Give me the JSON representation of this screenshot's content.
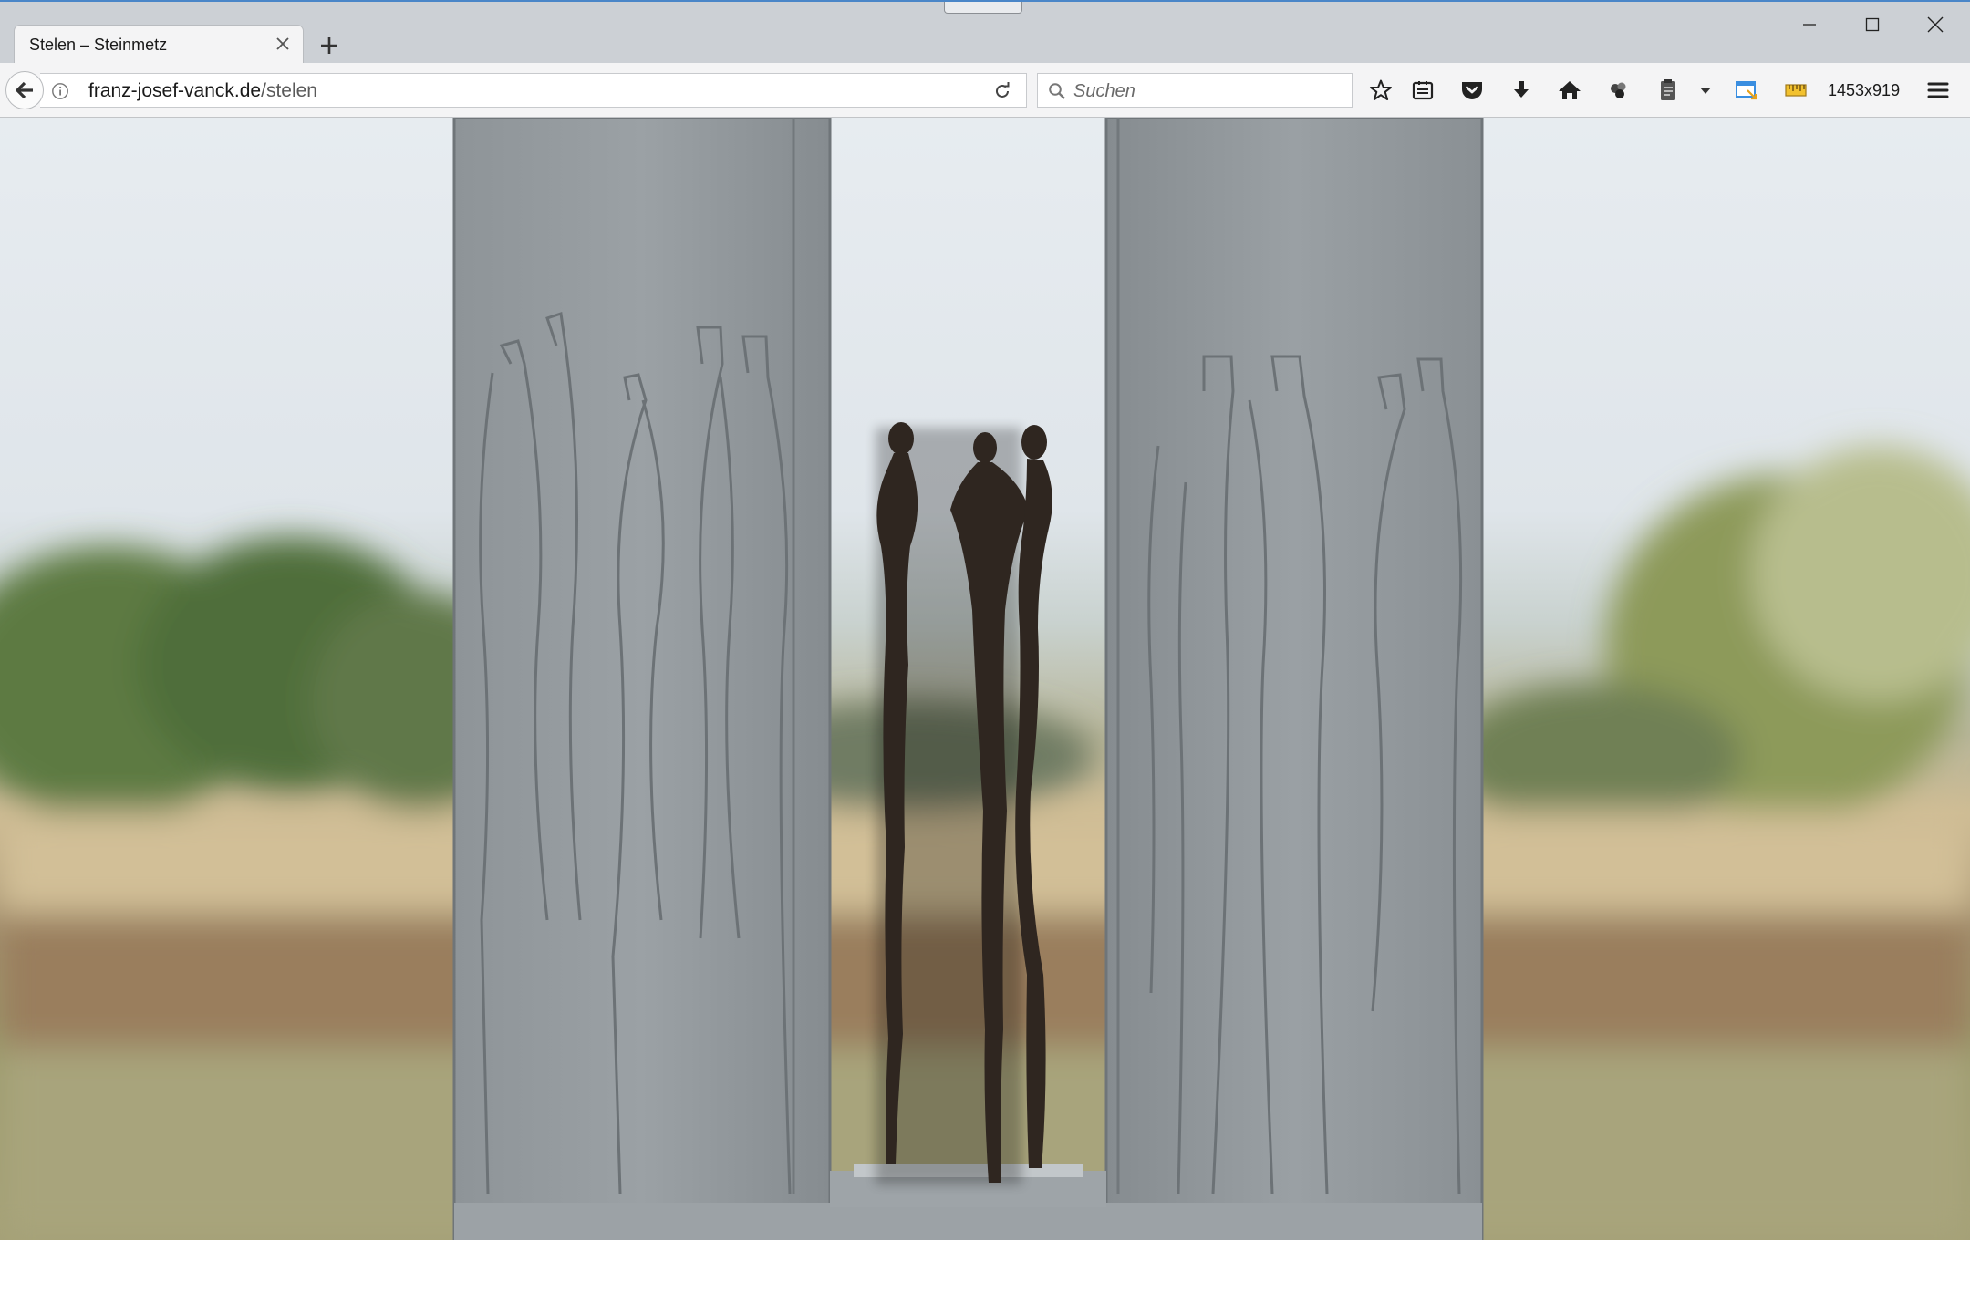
{
  "tab": {
    "title": "Stelen – Steinmetz",
    "close_icon": "close-icon"
  },
  "window_controls": {
    "minimize_icon": "minimize-icon",
    "maximize_icon": "maximize-icon",
    "close_icon": "close-icon"
  },
  "navbar": {
    "url_host": "franz-josef-vanck.de",
    "url_sep": "/",
    "url_path": "stelen",
    "search_placeholder": "Suchen",
    "resolution_label": "1453x919"
  },
  "toolbar_icons": [
    "bookmark-star-icon",
    "reading-list-icon",
    "pocket-icon",
    "download-icon",
    "home-icon",
    "extension-icon",
    "clipboard-icon",
    "dropdown-arrow-icon",
    "window-resize-icon",
    "ruler-icon",
    "hamburger-menu-icon"
  ],
  "colors": {
    "accent_line": "#4a86c8",
    "titlebar": "#ccd0d5",
    "toolbar": "#f4f4f5",
    "stone": "#8b9094",
    "bronze": "#2f2620"
  }
}
